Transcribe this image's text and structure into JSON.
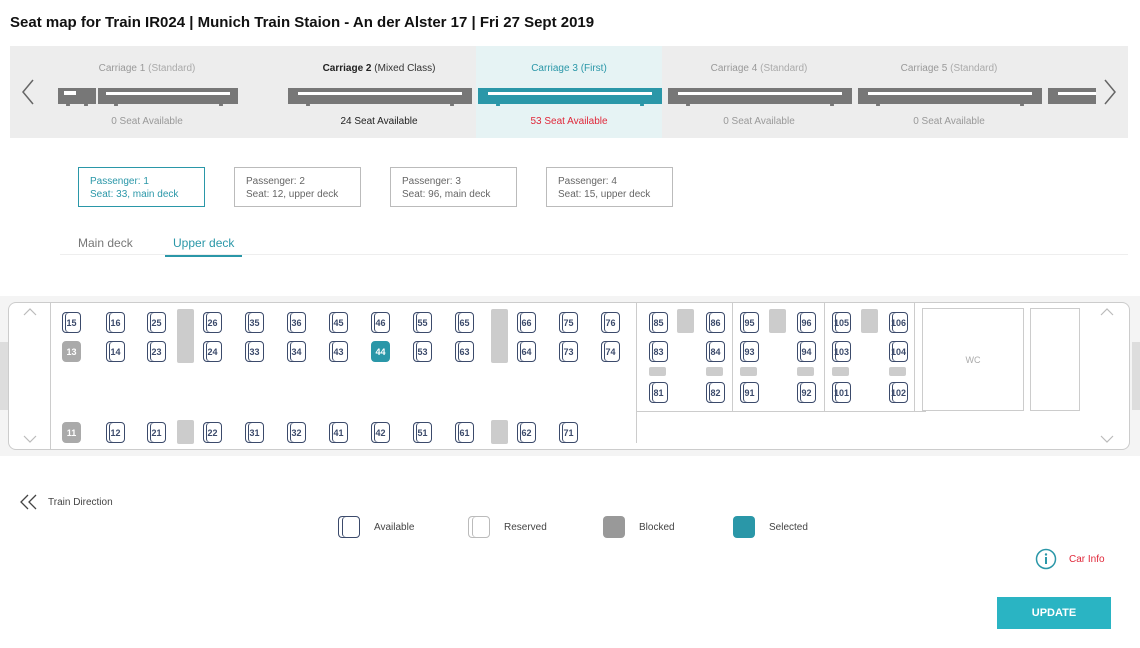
{
  "header": {
    "title": "Seat map for Train IR024 | Munich Train Staion - An der Alster 17 | Fri 27 Sept 2019"
  },
  "carriages": [
    {
      "name": "Carriage 1",
      "class": "(Standard)",
      "seats": "0 Seat Available"
    },
    {
      "name": "Carriage 2",
      "class": "(Mixed Class)",
      "seats": "24 Seat Available"
    },
    {
      "name": "Carriage 3",
      "class": "(First)",
      "seats": "53 Seat Available"
    },
    {
      "name": "Carriage 4",
      "class": "(Standard)",
      "seats": "0 Seat Available"
    },
    {
      "name": "Carriage 5",
      "class": "(Standard)",
      "seats": "0 Seat Available"
    }
  ],
  "passengers": [
    {
      "label": "Passenger: 1",
      "seat": "Seat: 33, main deck"
    },
    {
      "label": "Passenger: 2",
      "seat": "Seat: 12, upper deck"
    },
    {
      "label": "Passenger: 3",
      "seat": "Seat: 96, main deck"
    },
    {
      "label": "Passenger: 4",
      "seat": "Seat: 15, upper deck"
    }
  ],
  "deck_tabs": {
    "main": "Main deck",
    "upper": "Upper deck"
  },
  "seats": {
    "row_top": [
      "15",
      "16",
      "25",
      "26",
      "35",
      "36",
      "45",
      "46",
      "55",
      "65",
      "66",
      "75",
      "76"
    ],
    "row_mid": [
      "13",
      "14",
      "23",
      "24",
      "33",
      "34",
      "43",
      "44",
      "53",
      "63",
      "64",
      "73",
      "74"
    ],
    "row_bot": [
      "11",
      "12",
      "21",
      "22",
      "31",
      "32",
      "41",
      "42",
      "51",
      "61",
      "62",
      "71"
    ],
    "first_top": [
      "85",
      "86",
      "95",
      "96",
      "105",
      "106"
    ],
    "first_mid": [
      "83",
      "84",
      "93",
      "94",
      "103",
      "104"
    ],
    "first_bot": [
      "81",
      "82",
      "91",
      "92",
      "101",
      "102"
    ],
    "blocked": [
      "13",
      "11"
    ],
    "selected": [
      "44"
    ]
  },
  "wc_label": "WC",
  "direction_label": "Train Direction",
  "legend": {
    "available": "Available",
    "reserved": "Reserved",
    "blocked": "Blocked",
    "selected": "Selected"
  },
  "car_info_label": "Car Info",
  "update_label": "UPDATE",
  "colors": {
    "accent": "#2a97a8",
    "button": "#2ab4c3",
    "alert": "#e0283a",
    "seat_outline": "#3b4a6b"
  }
}
